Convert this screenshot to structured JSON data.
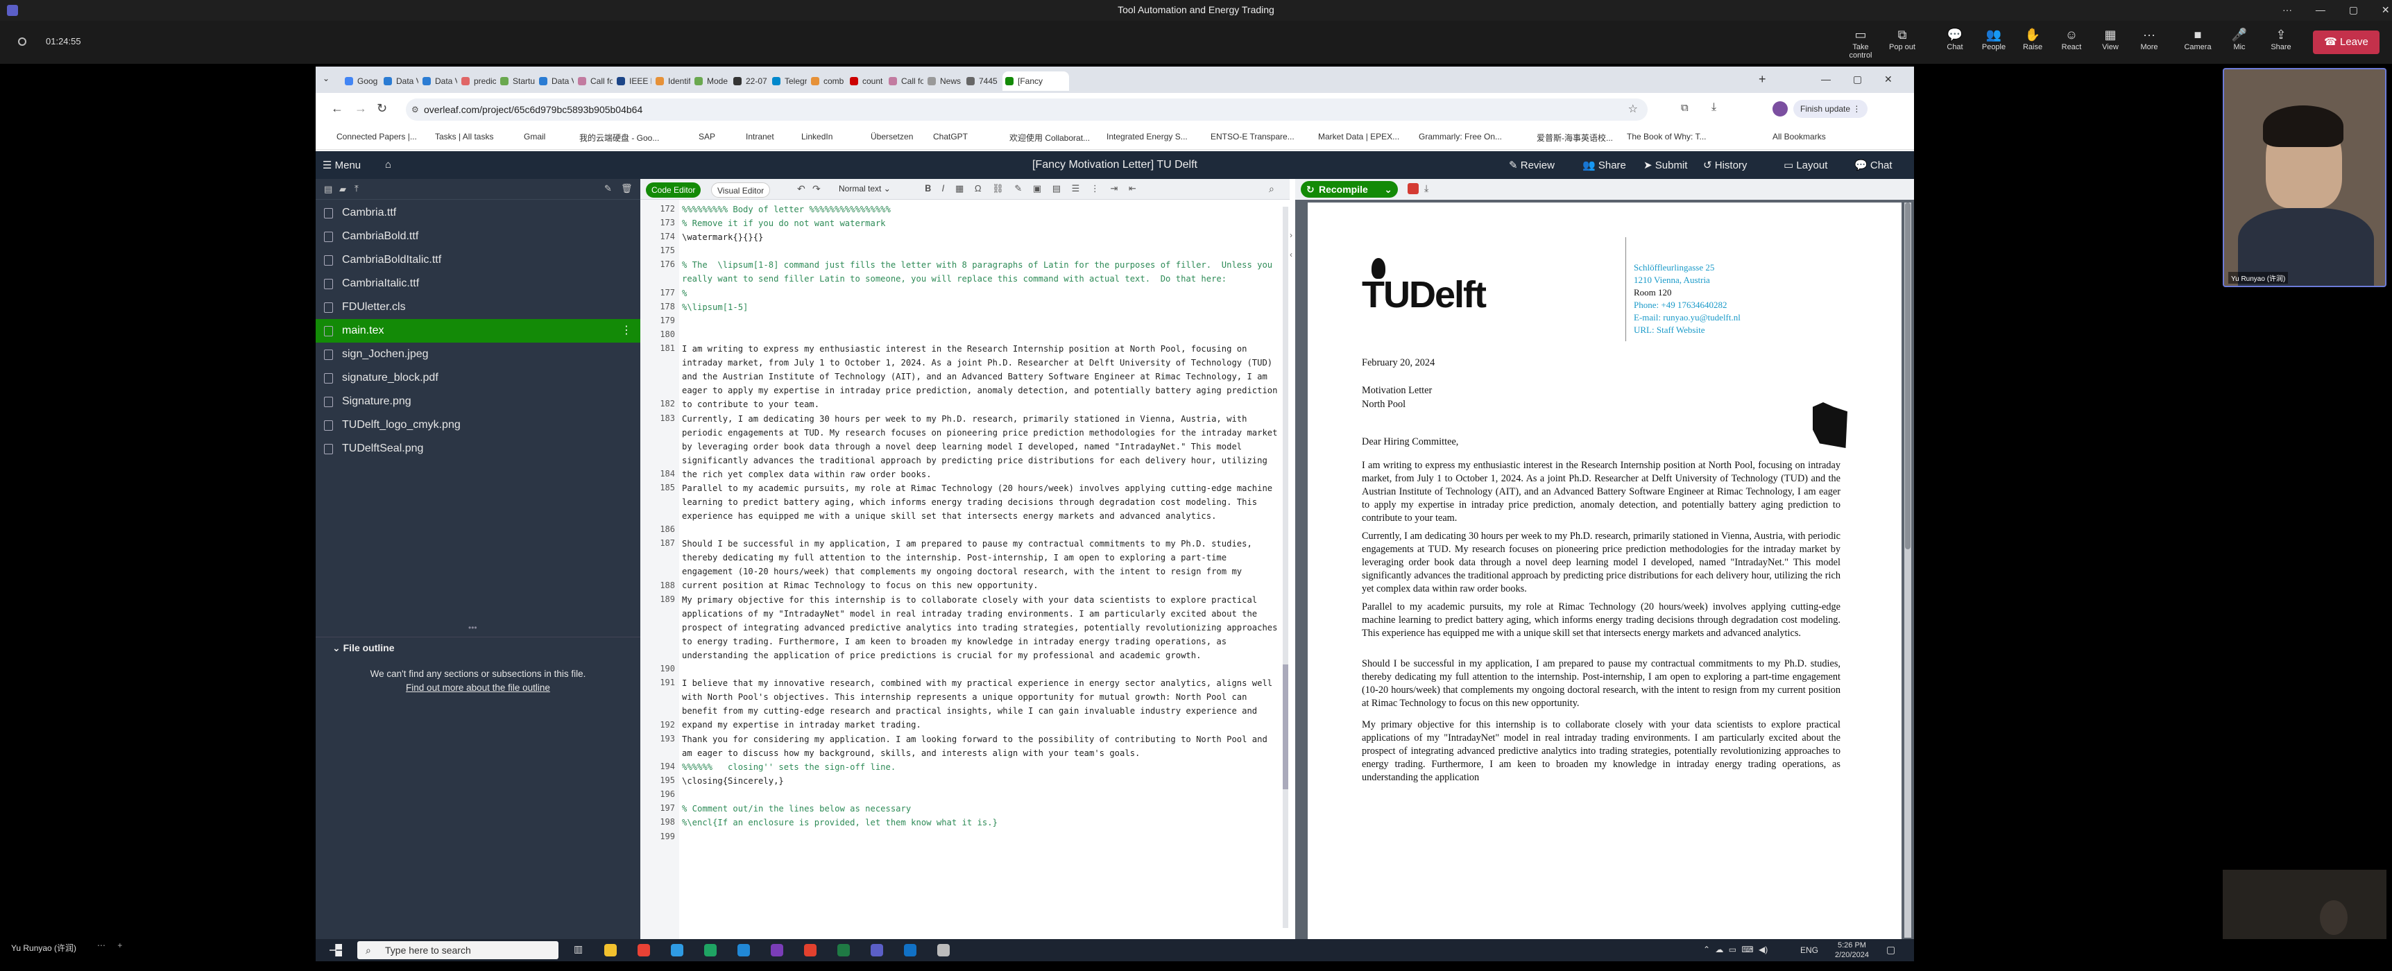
{
  "meeting": {
    "title": "Tool Automation and Energy Trading",
    "timer": "01:24:55",
    "controls": [
      {
        "icon": "take-control-icon",
        "label": "Take control"
      },
      {
        "icon": "pop-out-icon",
        "label": "Pop out"
      },
      {
        "icon": "chat-icon",
        "label": "Chat"
      },
      {
        "icon": "people-icon",
        "label": "People",
        "count": "2"
      },
      {
        "icon": "raise-hand-icon",
        "label": "Raise"
      },
      {
        "icon": "react-icon",
        "label": "React"
      },
      {
        "icon": "view-icon",
        "label": "View"
      },
      {
        "icon": "more-icon",
        "label": "More"
      },
      {
        "icon": "camera-icon",
        "label": "Camera"
      },
      {
        "icon": "mic-icon",
        "label": "Mic"
      },
      {
        "icon": "share-icon",
        "label": "Share"
      }
    ],
    "leave_label": "Leave",
    "self_name": "Yu Runyao (许润)",
    "bottom_name": "Yu Runyao (许润)"
  },
  "browser": {
    "tabs": [
      "Goog",
      "Data V",
      "Data V",
      "predic",
      "Startu",
      "Data V",
      "Call fo",
      "IEEE Eu",
      "Identif",
      "Mode",
      "22-07",
      "Telegr",
      "comb",
      "count",
      "Call fo",
      "News",
      "7445",
      "[Fancy"
    ],
    "url": "overleaf.com/project/65c6d979bc5893b905b04b64",
    "update_label": "Finish update",
    "bookmarks": [
      "Connected Papers |...",
      "Tasks | All tasks",
      "Gmail",
      "我的云端硬盘 - Goo...",
      "SAP",
      "Intranet",
      "LinkedIn",
      "Übersetzen",
      "ChatGPT",
      "欢迎使用 Collaborat...",
      "Integrated Energy S...",
      "ENTSO-E Transpare...",
      "Market Data | EPEX...",
      "Grammarly: Free On...",
      "爱普斯-海事英语校...",
      "The Book of Why: T...",
      "All Bookmarks"
    ]
  },
  "overleaf": {
    "menu_label": "Menu",
    "title": "[Fancy Motivation Letter] TU Delft",
    "header_buttons": [
      "Review",
      "Share",
      "Submit",
      "History",
      "Layout",
      "Chat"
    ],
    "files": [
      "Cambria.ttf",
      "CambriaBold.ttf",
      "CambriaBoldItalic.ttf",
      "CambriaItalic.ttf",
      "FDUletter.cls",
      "main.tex",
      "sign_Jochen.jpeg",
      "signature_block.pdf",
      "Signature.png",
      "TUDelft_logo_cmyk.png",
      "TUDelftSeal.png"
    ],
    "active_file": "main.tex",
    "outline_title": "File outline",
    "outline_msg": "We can't find any sections or subsections in this file.",
    "outline_link": "Find out more about the file outline",
    "code_editor_label": "Code Editor",
    "visual_editor_label": "Visual Editor",
    "text_style": "Normal text",
    "recompile_label": "Recompile",
    "code_lines": [
      {
        "n": "172",
        "t": "%%%%%%%%% Body of letter %%%%%%%%%%%%%%%%",
        "c": true
      },
      {
        "n": "173",
        "t": "% Remove it if you do not want watermark",
        "c": true
      },
      {
        "n": "174",
        "t": "\\watermark{}{}{}",
        "c": false
      },
      {
        "n": "175",
        "t": "",
        "c": false
      },
      {
        "n": "176",
        "t": "% The  \\lipsum[1-8] command just fills the letter with 8 paragraphs of Latin for the purposes of filler.  Unless you really want to send filler Latin to someone, you will replace this command with actual text.  Do that here:",
        "c": true
      },
      {
        "n": "177",
        "t": "%",
        "c": true
      },
      {
        "n": "178",
        "t": "%\\lipsum[1-5]",
        "c": true
      },
      {
        "n": "179",
        "t": "",
        "c": false
      },
      {
        "n": "180",
        "t": "",
        "c": false
      },
      {
        "n": "181",
        "t": "I am writing to express my enthusiastic interest in the Research Internship position at North Pool, focusing on intraday market, from July 1 to October 1, 2024. As a joint Ph.D. Researcher at Delft University of Technology (TUD) and the Austrian Institute of Technology (AIT), and an Advanced Battery Software Engineer at Rimac Technology, I am eager to apply my expertise in intraday price prediction, anomaly detection, and potentially battery aging prediction to contribute to your team.",
        "c": false
      },
      {
        "n": "182",
        "t": "",
        "c": false
      },
      {
        "n": "183",
        "t": "Currently, I am dedicating 30 hours per week to my Ph.D. research, primarily stationed in Vienna, Austria, with periodic engagements at TUD. My research focuses on pioneering price prediction methodologies for the intraday market by leveraging order book data through a novel deep learning model I developed, named \"IntradayNet.\" This model significantly advances the traditional approach by predicting price distributions for each delivery hour, utilizing the rich yet complex data within raw order books.",
        "c": false
      },
      {
        "n": "184",
        "t": "",
        "c": false
      },
      {
        "n": "185",
        "t": "Parallel to my academic pursuits, my role at Rimac Technology (20 hours/week) involves applying cutting-edge machine learning to predict battery aging, which informs energy trading decisions through degradation cost modeling. This experience has equipped me with a unique skill set that intersects energy markets and advanced analytics.",
        "c": false
      },
      {
        "n": "186",
        "t": "",
        "c": false
      },
      {
        "n": "187",
        "t": "Should I be successful in my application, I am prepared to pause my contractual commitments to my Ph.D. studies, thereby dedicating my full attention to the internship. Post-internship, I am open to exploring a part-time engagement (10-20 hours/week) that complements my ongoing doctoral research, with the intent to resign from my current position at Rimac Technology to focus on this new opportunity.",
        "c": false
      },
      {
        "n": "188",
        "t": "",
        "c": false
      },
      {
        "n": "189",
        "t": "My primary objective for this internship is to collaborate closely with your data scientists to explore practical applications of my \"IntradayNet\" model in real intraday trading environments. I am particularly excited about the prospect of integrating advanced predictive analytics into trading strategies, potentially revolutionizing approaches to energy trading. Furthermore, I am keen to broaden my knowledge in intraday energy trading operations, as understanding the application of price predictions is crucial for my professional and academic growth.",
        "c": false
      },
      {
        "n": "190",
        "t": "",
        "c": false
      },
      {
        "n": "191",
        "t": "I believe that my innovative research, combined with my practical experience in energy sector analytics, aligns well with North Pool's objectives. This internship represents a unique opportunity for mutual growth: North Pool can benefit from my cutting-edge research and practical insights, while I can gain invaluable industry experience and expand my expertise in intraday market trading.",
        "c": false
      },
      {
        "n": "192",
        "t": "",
        "c": false
      },
      {
        "n": "193",
        "t": "Thank you for considering my application. I am looking forward to the possibility of contributing to North Pool and am eager to discuss how my background, skills, and interests align with your team's goals.",
        "c": false
      },
      {
        "n": "194",
        "t": "%%%%%%   closing'' sets the sign-off line.",
        "c": true
      },
      {
        "n": "195",
        "t": "\\closing{Sincerely,}",
        "c": false
      },
      {
        "n": "196",
        "t": "",
        "c": false
      },
      {
        "n": "197",
        "t": "% Comment out/in the lines below as necessary",
        "c": true
      },
      {
        "n": "198",
        "t": "%\\encl{If an enclosure is provided, let them know what it is.}",
        "c": true
      },
      {
        "n": "199",
        "t": "",
        "c": false
      }
    ]
  },
  "pdf": {
    "logo": "TUDelft",
    "address": [
      "Schlöffleurlingasse 25",
      "1210 Vienna, Austria",
      "Room 120",
      "Phone: +49 17634640282",
      "E-mail: runyao.yu@tudelft.nl",
      "URL: Staff Website"
    ],
    "date": "February 20, 2024",
    "subject": "Motivation Letter",
    "recipient": "North Pool",
    "salutation": "Dear Hiring Committee,",
    "paragraphs": [
      "I am writing to express my enthusiastic interest in the Research Internship position at North Pool, focusing on intraday market, from July 1 to October 1, 2024. As a joint Ph.D. Researcher at Delft University of Technology (TUD) and the Austrian Institute of Technology (AIT), and an Advanced Battery Software Engineer at Rimac Technology, I am eager to apply my expertise in intraday price prediction, anomaly detection, and potentially battery aging prediction to contribute to your team.",
      "Currently, I am dedicating 30 hours per week to my Ph.D. research, primarily stationed in Vienna, Austria, with periodic engagements at TUD. My research focuses on pioneering price prediction methodologies for the intraday market by leveraging order book data through a novel deep learning model I developed, named \"IntradayNet.\" This model significantly advances the traditional approach by predicting price distributions for each delivery hour, utilizing the rich yet complex data within raw order books.",
      "Parallel to my academic pursuits, my role at Rimac Technology (20 hours/week) involves applying cutting-edge machine learning to predict battery aging, which informs energy trading decisions through degradation cost modeling. This experience has equipped me with a unique skill set that intersects energy markets and advanced analytics.",
      "Should I be successful in my application, I am prepared to pause my contractual commitments to my Ph.D. studies, thereby dedicating my full attention to the internship. Post-internship, I am open to exploring a part-time engagement (10-20 hours/week) that complements my ongoing doctoral research, with the intent to resign from my current position at Rimac Technology to focus on this new opportunity.",
      "My primary objective for this internship is to collaborate closely with your data scientists to explore practical applications of my \"IntradayNet\" model in real intraday trading environments. I am particularly excited about the prospect of integrating advanced predictive analytics into trading strategies, potentially revolutionizing approaches to energy trading. Furthermore, I am keen to broaden my knowledge in intraday energy trading operations, as understanding the application"
    ]
  },
  "taskbar": {
    "search_placeholder": "Type here to search",
    "lang": "ENG",
    "time": "5:26 PM",
    "date": "2/20/2024"
  },
  "colors": {
    "overleaf_green": "#138a07",
    "leave_red": "#c4314b",
    "tud_cyan": "#1a9ac9"
  }
}
